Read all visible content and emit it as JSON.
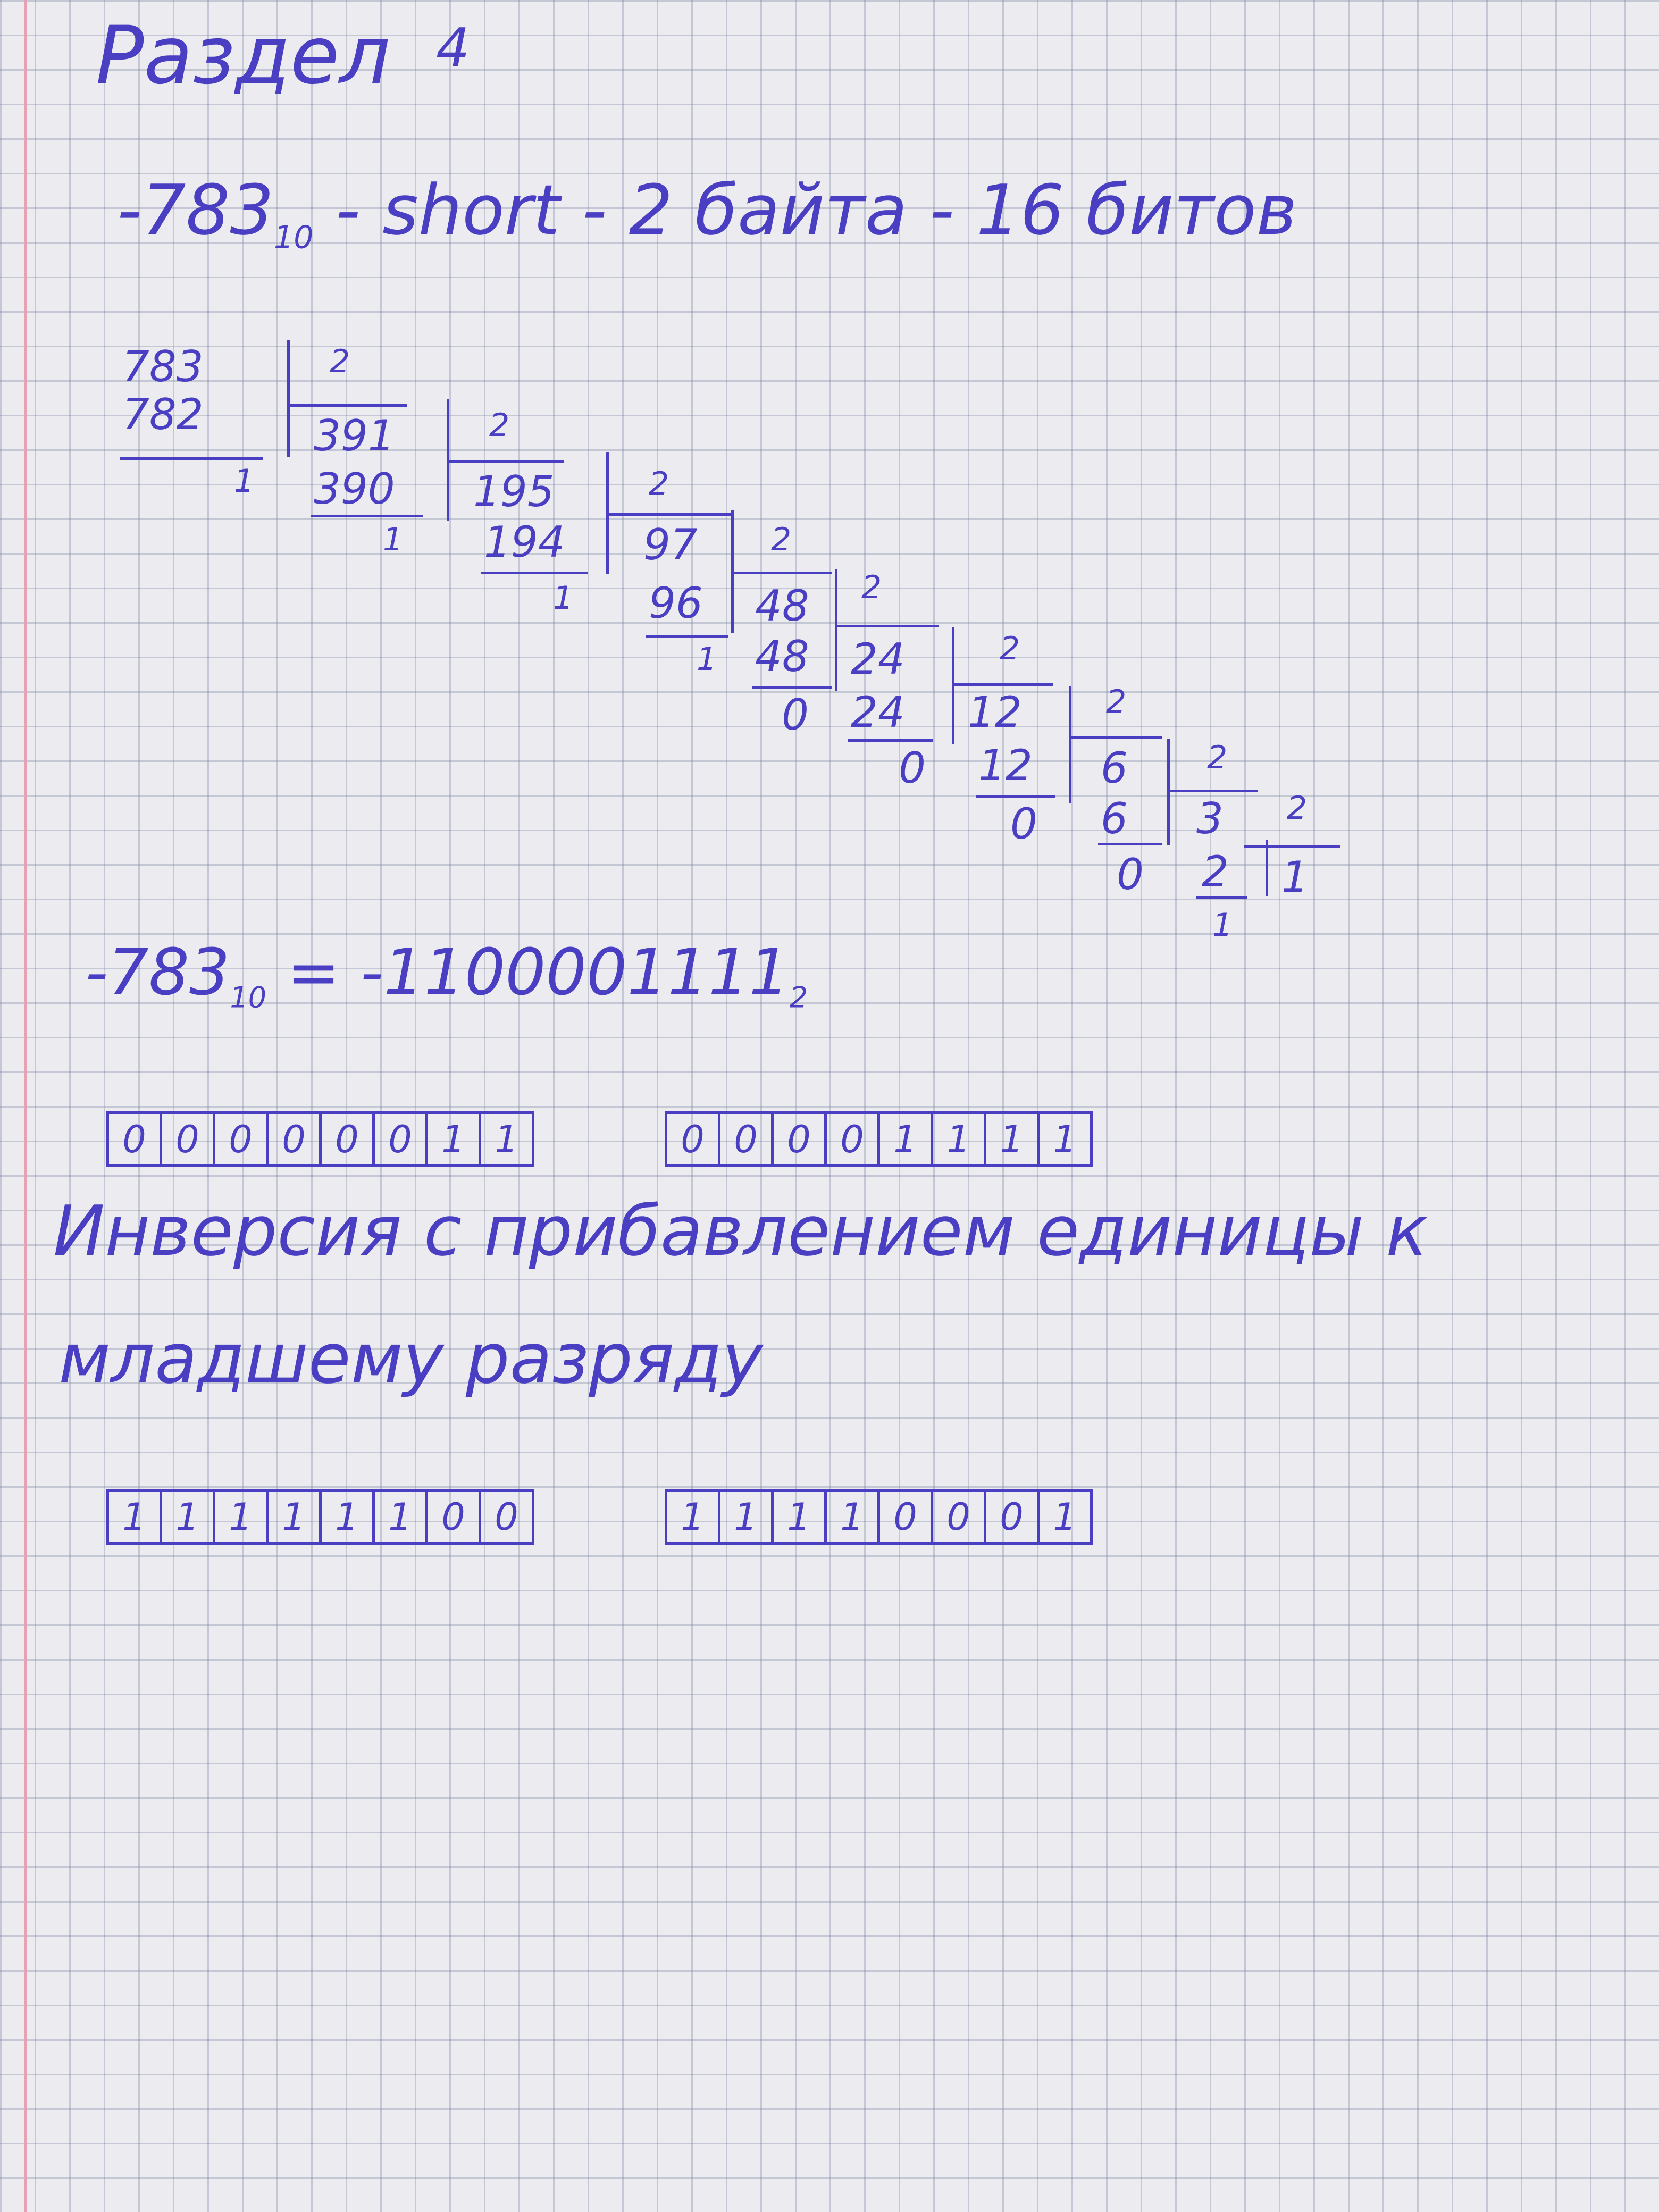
{
  "title": {
    "word": "Раздел",
    "number": "4"
  },
  "header": {
    "value": "-783",
    "base": "10",
    "rest": "- short - 2 байта - 16 битов"
  },
  "division": {
    "divisor": "2",
    "steps": [
      {
        "dividend": "783",
        "subtrahend": "782",
        "remainder": "1"
      },
      {
        "dividend": "391",
        "subtrahend": "390",
        "remainder": "1"
      },
      {
        "dividend": "195",
        "subtrahend": "194",
        "remainder": "1"
      },
      {
        "dividend": "97",
        "subtrahend": "96",
        "remainder": "1"
      },
      {
        "dividend": "48",
        "subtrahend": "48",
        "remainder": "0"
      },
      {
        "dividend": "24",
        "subtrahend": "24",
        "remainder": "0"
      },
      {
        "dividend": "12",
        "subtrahend": "12",
        "remainder": "0"
      },
      {
        "dividend": "6",
        "subtrahend": "6",
        "remainder": "0"
      },
      {
        "dividend": "3",
        "subtrahend": "2",
        "remainder": "1"
      }
    ],
    "final_quotient": "1"
  },
  "result": {
    "lhs": "-783",
    "lhs_base": "10",
    "rhs": "= -1100001111",
    "rhs_base": "2"
  },
  "direct_code": {
    "high_byte": [
      "0",
      "0",
      "0",
      "0",
      "0",
      "0",
      "1",
      "1"
    ],
    "low_byte": [
      "0",
      "0",
      "0",
      "0",
      "1",
      "1",
      "1",
      "1"
    ]
  },
  "note": {
    "line1": "Инверсия с прибавлением единицы к",
    "line2": "младшему разряду"
  },
  "twos_complement": {
    "high_byte": [
      "1",
      "1",
      "1",
      "1",
      "1",
      "1",
      "0",
      "0"
    ],
    "low_byte": [
      "1",
      "1",
      "1",
      "1",
      "0",
      "0",
      "0",
      "1"
    ]
  }
}
